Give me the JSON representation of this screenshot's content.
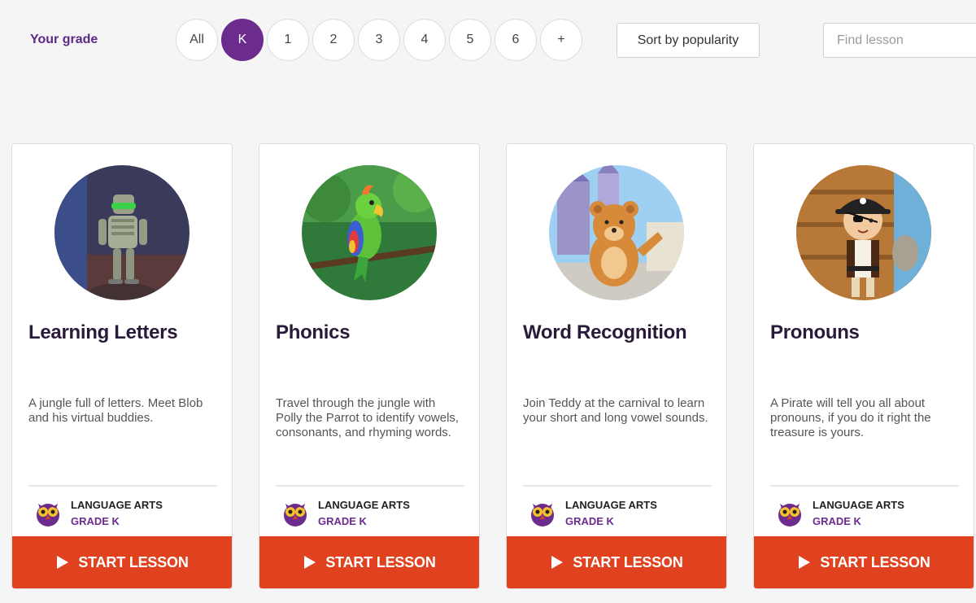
{
  "filters": {
    "grade_label": "Your grade",
    "grades": [
      "All",
      "K",
      "1",
      "2",
      "3",
      "4",
      "5",
      "6",
      "+"
    ],
    "active_grade": "K",
    "sort_label": "Sort by popularity",
    "search_placeholder": "Find lesson"
  },
  "lessons": [
    {
      "title": "Learning Letters",
      "description": "A jungle full of letters. Meet Blob and his virtual buddies.",
      "subject": "LANGUAGE ARTS",
      "grade": "GRADE K",
      "button": "START LESSON",
      "icon": "robot-character-icon"
    },
    {
      "title": "Phonics",
      "description": "Travel through the jungle with Polly the Parrot to identify vowels, consonants, and rhyming words.",
      "subject": "LANGUAGE ARTS",
      "grade": "GRADE K",
      "button": "START LESSON",
      "icon": "parrot-character-icon"
    },
    {
      "title": "Word Recognition",
      "description": "Join Teddy at the carnival to learn your short and long vowel sounds.",
      "subject": "LANGUAGE ARTS",
      "grade": "GRADE K",
      "button": "START LESSON",
      "icon": "teddy-bear-character-icon"
    },
    {
      "title": "Pronouns",
      "description": "A Pirate will tell you all about pronouns, if you do it right the treasure is yours.",
      "subject": "LANGUAGE ARTS",
      "grade": "GRADE K",
      "button": "START LESSON",
      "icon": "pirate-character-icon"
    }
  ],
  "colors": {
    "accent_purple": "#6b2c8e",
    "button_red": "#e0411e"
  }
}
